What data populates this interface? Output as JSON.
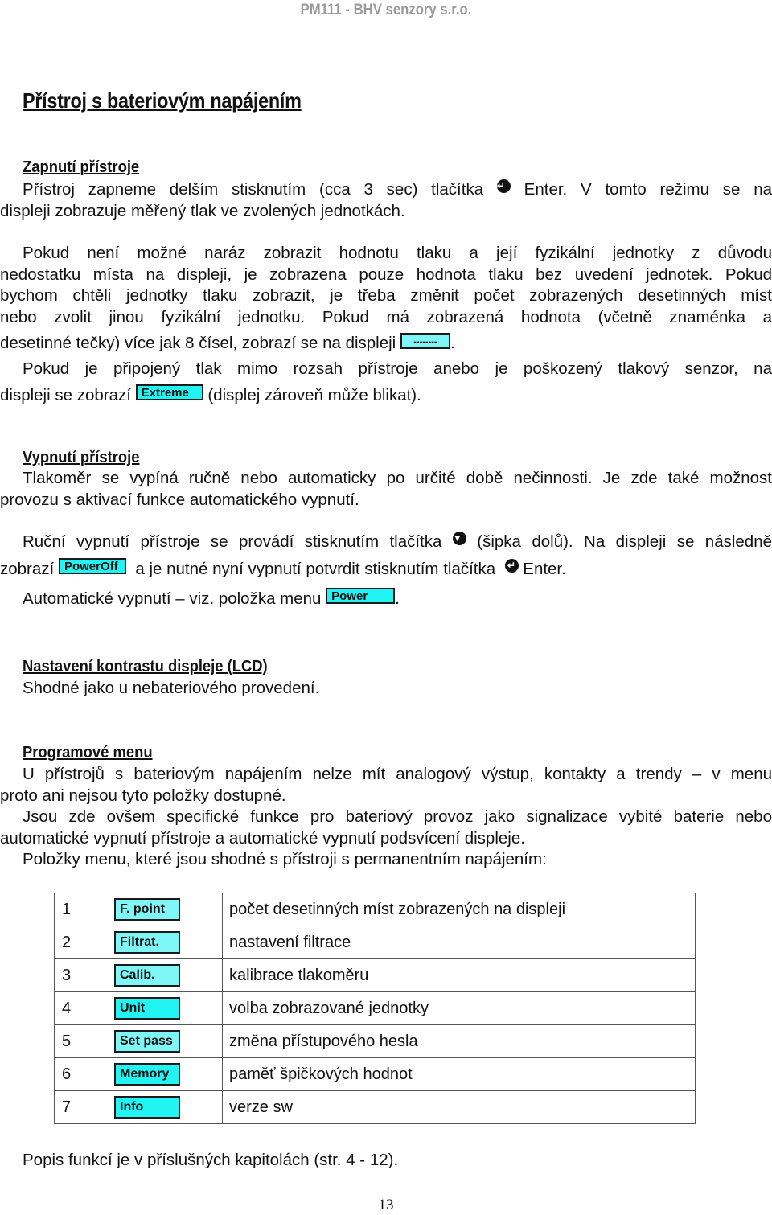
{
  "header": "PM111 - BHV senzory s.r.o.",
  "title": "Přístroj s bateriovým napájením",
  "colors": {
    "lcd_cyan": "#22f4f4",
    "lcd_pale_cyan": "#7ff7f7",
    "header_gray": "#9a9a9a"
  },
  "icons": {
    "enter": "enter-button-icon",
    "down": "down-arrow-button-icon"
  },
  "section_on": {
    "heading": "Zapnutí přístroje",
    "p1_a": "Přístroj zapneme delším stisknutím (cca 3 sec) tlačítka",
    "p1_b": "Enter. V tomto režimu se na",
    "p1_c": "displeji zobrazuje měřený tlak ve zvolených jednotkách.",
    "p2_l1": "Pokud není možné naráz zobrazit hodnotu tlaku a její fyzikální jednotky z důvodu",
    "p2_l2": "nedostatku místa na displeji, je zobrazena pouze hodnota tlaku bez uvedení jednotek. Pokud",
    "p2_l3": "bychom chtěli jednotky tlaku zobrazit, je třeba změnit počet zobrazených desetinných míst",
    "p2_l4": "nebo zvolit jinou fyzikální jednotku. Pokud má zobrazená hodnota (včetně znaménka a",
    "p2_l5a": "desetinné tečky) více jak 8 čísel, zobrazí se na displeji",
    "lcd_overflow": "--------",
    "p2_l5b": ".",
    "p3_l1": "Pokud je připojený tlak mimo rozsah přístroje anebo je poškozený tlakový senzor, na",
    "p3_l2a": "displeji se zobrazí",
    "lcd_extreme": "Extreme",
    "p3_l2b": "(displej zároveň může blikat)."
  },
  "section_off": {
    "heading": "Vypnutí přístroje",
    "p1_l1": "Tlakoměr se vypíná ručně nebo automaticky po určité době nečinnosti. Je zde také možnost",
    "p1_l2": "provozu s aktivací funkce automatického vypnutí.",
    "p2_l1a": "Ruční vypnutí přístroje se provádí stisknutím tlačítka",
    "p2_l1b": "(šipka dolů). Na displeji se následně",
    "p2_l2a": "zobrazí",
    "lcd_poweroff": "PowerOff",
    "p2_l2b": "a je nutné nyní vypnutí potvrdit stisknutím tlačítka",
    "p2_l2c": "Enter.",
    "p3_a": "Automatické vypnutí – viz. položka menu",
    "lcd_power": "Power",
    "p3_b": "."
  },
  "section_lcd": {
    "heading": "Nastavení kontrastu displeje (LCD)",
    "text": "Shodné jako u nebateriového provedení."
  },
  "section_menu": {
    "heading": "Programové menu",
    "p1_l1": "U přístrojů s bateriovým napájením nelze mít analogový výstup, kontakty a trendy – v menu",
    "p1_l2": "proto ani nejsou tyto položky dostupné.",
    "p2_l1": "Jsou zde ovšem specifické funkce pro bateriový provoz jako signalizace vybité baterie nebo",
    "p2_l2": "automatické vypnutí přístroje a automatické vypnutí podsvícení displeje.",
    "p3": "Položky menu, které jsou shodné s přístroji s permanentním napájením:",
    "items": [
      {
        "num": "1",
        "code": "F. point",
        "desc": "počet desetinných míst zobrazených na displeji"
      },
      {
        "num": "2",
        "code": "Filtrat.",
        "desc": "nastavení filtrace"
      },
      {
        "num": "3",
        "code": "Calib.",
        "desc": "kalibrace tlakoměru"
      },
      {
        "num": "4",
        "code": "Unit",
        "desc": "volba zobrazované jednotky"
      },
      {
        "num": "5",
        "code": "Set pass",
        "desc": "změna přístupového hesla"
      },
      {
        "num": "6",
        "code": "Memory",
        "desc": "paměť špičkových hodnot"
      },
      {
        "num": "7",
        "code": "Info",
        "desc": "verze sw"
      }
    ],
    "footer_note": "Popis funkcí je v příslušných kapitolách (str. 4 - 12)."
  },
  "page_number": "13"
}
